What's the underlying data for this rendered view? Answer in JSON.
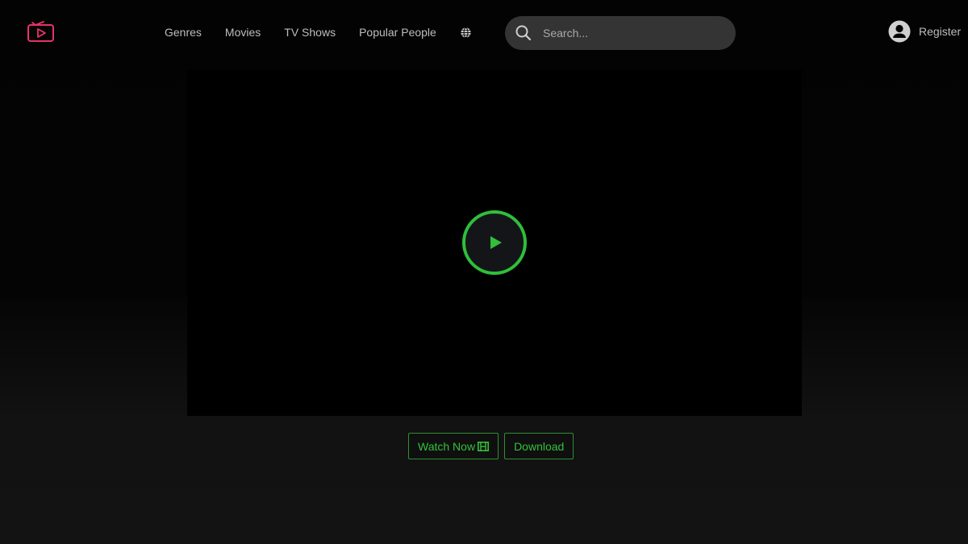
{
  "header": {
    "logo_icon": "tv-play-icon",
    "brand_color": "#e8336a",
    "nav": [
      {
        "label": "Genres"
      },
      {
        "label": "Movies"
      },
      {
        "label": "TV Shows"
      },
      {
        "label": "Popular People"
      }
    ],
    "language_icon": "globe-icon",
    "search": {
      "placeholder": "Search...",
      "value": "",
      "icon": "search-icon"
    },
    "account": {
      "label": "Register",
      "icon": "user-circle-icon"
    }
  },
  "player": {
    "play_icon": "play-icon",
    "accent_color": "#2fbf3a"
  },
  "actions": {
    "watch_now_label": "Watch Now",
    "watch_now_icon": "film-icon",
    "download_label": "Download"
  }
}
